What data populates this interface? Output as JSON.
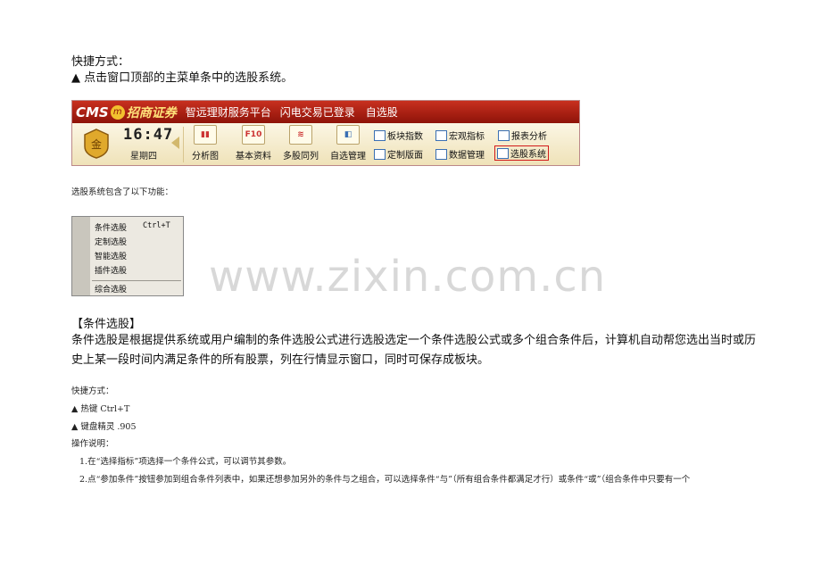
{
  "intro": {
    "heading": "快捷方式：",
    "bullet": "▲  点击窗口顶部的主菜单条中的选股系统。"
  },
  "toolbar": {
    "logo": "CMS",
    "logo_mark": "m",
    "brand": "招商证券",
    "slogan": "智远理财服务平台",
    "status": "闪电交易已登录",
    "current": "自选股",
    "clock": "16:47",
    "weekday": "星期四",
    "buttons": [
      {
        "label": "分析图",
        "icon": "candle-chart-icon"
      },
      {
        "label": "基本资料",
        "icon": "F10"
      },
      {
        "label": "多股同列",
        "icon": "multi-line-icon"
      },
      {
        "label": "自选管理",
        "icon": "user-chart-icon"
      }
    ],
    "small_items": [
      {
        "label": "板块指数"
      },
      {
        "label": "宏观指标"
      },
      {
        "label": "报表分析"
      },
      {
        "label": "定制版面"
      },
      {
        "label": "数据管理"
      },
      {
        "label": "选股系统"
      }
    ]
  },
  "caption_features": "选股系统包含了以下功能：",
  "menu": {
    "items": [
      {
        "label": "条件选股",
        "shortcut": "Ctrl+T"
      },
      {
        "label": "定制选股"
      },
      {
        "label": "智能选股"
      },
      {
        "label": "插件选股"
      },
      {
        "label": "综合选股"
      }
    ]
  },
  "watermark": "www.zixin.com.cn",
  "section": {
    "title": "【条件选股】",
    "body": "条件选股是根据提供系统或用户编制的条件选股公式进行选股选定一个条件选股公式或多个组合条件后，计算机自动帮您选出当时或历史上某一段时间内满足条件的所有股票，列在行情显示窗口，同时可保存成板块。"
  },
  "shortcuts": {
    "heading": "快捷方式：",
    "items": [
      "▲  热键 Ctrl+T",
      "▲  键盘精灵 .905"
    ]
  },
  "instructions": {
    "heading": "操作说明：",
    "steps": [
      "1.在“选择指标”项选择一个条件公式，可以调节其参数。",
      "2.点“参加条件”按钮参加到组合条件列表中，如果还想参加另外的条件与之组合，可以选择条件“与”（所有组合条件都满足才行）或条件“或”（组合条件中只要有一个"
    ]
  }
}
